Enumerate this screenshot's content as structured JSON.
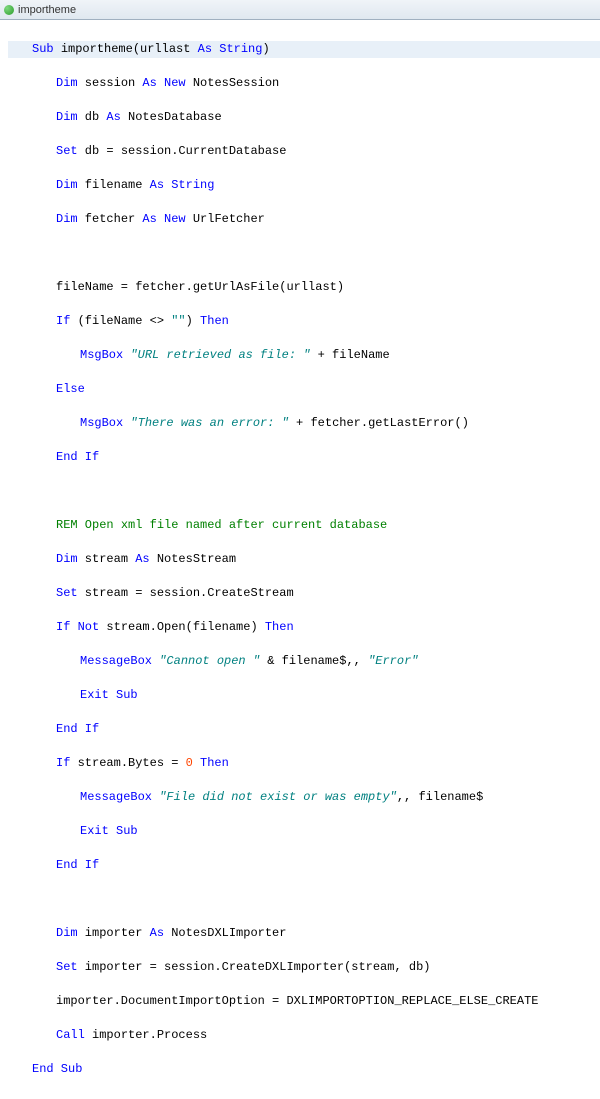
{
  "tab": {
    "label": "importheme"
  },
  "code": {
    "l1": {
      "kw1": "Sub",
      "name": "importheme",
      "paren_open": "(",
      "param": "urllast ",
      "kw2": "As String",
      "paren_close": ")"
    },
    "l2": {
      "kw1": "Dim",
      "var": " session ",
      "kw2": "As New",
      "type": " NotesSession"
    },
    "l3": {
      "kw1": "Dim",
      "var": " db ",
      "kw2": "As",
      "type": " NotesDatabase"
    },
    "l4": {
      "kw1": "Set",
      "rest": " db = session.CurrentDatabase"
    },
    "l5": {
      "kw1": "Dim",
      "var": " filename ",
      "kw2": "As String"
    },
    "l6": {
      "kw1": "Dim",
      "var": " fetcher ",
      "kw2": "As New",
      "type": " UrlFetcher"
    },
    "l7": {
      "text": "fileName = fetcher.getUrlAsFile(urllast)"
    },
    "l8": {
      "kw1": "If",
      "mid": " (fileName <> ",
      "str": "\"\"",
      "mid2": ") ",
      "kw2": "Then"
    },
    "l9": {
      "kw1": "MsgBox",
      "sp": " ",
      "str": "\"URL retrieved as file: \"",
      "rest": " + fileName"
    },
    "l10": {
      "kw1": "Else"
    },
    "l11": {
      "kw1": "MsgBox",
      "sp": " ",
      "str": "\"There was an error: \"",
      "rest": " + fetcher.getLastError()"
    },
    "l12": {
      "kw1": "End If"
    },
    "l13": {
      "kw1": "REM",
      "rest": " Open xml file named after current database"
    },
    "l14": {
      "kw1": "Dim",
      "var": " stream ",
      "kw2": "As",
      "type": " NotesStream"
    },
    "l15": {
      "kw1": "Set",
      "rest": " stream = session.CreateStream"
    },
    "l16": {
      "kw1": "If Not",
      "mid": " stream.Open(filename) ",
      "kw2": "Then"
    },
    "l17": {
      "kw1": "MessageBox",
      "sp": " ",
      "str": "\"Cannot open \"",
      "mid": " & filename$,, ",
      "str2": "\"Error\""
    },
    "l18": {
      "kw1": "Exit Sub"
    },
    "l19": {
      "kw1": "End If"
    },
    "l20": {
      "kw1": "If",
      "mid": " stream.Bytes = ",
      "num": "0",
      "sp": " ",
      "kw2": "Then"
    },
    "l21": {
      "kw1": "MessageBox",
      "sp": " ",
      "str": "\"File did not exist or was empty\"",
      "rest": ",, filename$"
    },
    "l22": {
      "kw1": "Exit Sub"
    },
    "l23": {
      "kw1": "End If"
    },
    "l24": {
      "kw1": "Dim",
      "var": " importer ",
      "kw2": "As",
      "type": " NotesDXLImporter"
    },
    "l25": {
      "kw1": "Set",
      "rest": " importer = session.CreateDXLImporter(stream, db)"
    },
    "l26": {
      "text": "importer.DocumentImportOption = DXLIMPORTOPTION_REPLACE_ELSE_CREATE"
    },
    "l27": {
      "kw1": "Call",
      "rest": " importer.Process"
    },
    "l28": {
      "kw1": "End Sub"
    }
  }
}
